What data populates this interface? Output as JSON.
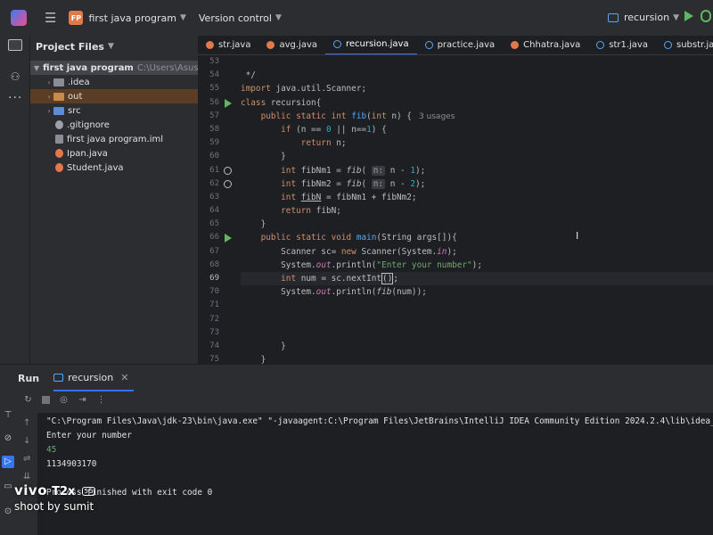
{
  "titlebar": {
    "project_badge": "FP",
    "project_name": "first java program",
    "version_control": "Version control",
    "run_config": "recursion"
  },
  "project_panel": {
    "title": "Project Files",
    "root_name": "first java program",
    "root_path": "C:\\Users\\Asus\\Id",
    "items": [
      {
        "label": ".idea",
        "kind": "folder"
      },
      {
        "label": "out",
        "kind": "folder-orange"
      },
      {
        "label": "src",
        "kind": "folder-blue"
      },
      {
        "label": ".gitignore",
        "kind": "git"
      },
      {
        "label": "first java program.iml",
        "kind": "iml"
      },
      {
        "label": "Ipan.java",
        "kind": "java"
      },
      {
        "label": "Student.java",
        "kind": "java"
      }
    ]
  },
  "editor": {
    "tabs": [
      {
        "label": "str.java",
        "icon": "java-icon"
      },
      {
        "label": "avg.java",
        "icon": "java-icon"
      },
      {
        "label": "recursion.java",
        "icon": "class-icon",
        "active": true
      },
      {
        "label": "practice.java",
        "icon": "class-icon"
      },
      {
        "label": "Chhatra.java",
        "icon": "java-icon"
      },
      {
        "label": "str1.java",
        "icon": "class-icon"
      },
      {
        "label": "substr.ja",
        "icon": "class-icon"
      }
    ],
    "line_numbers": [
      "53",
      "54",
      "55",
      "56",
      "57",
      "58",
      "59",
      "60",
      "61",
      "62",
      "63",
      "64",
      "65",
      "66",
      "67",
      "68",
      "69",
      "70",
      "71",
      "72",
      "73",
      "74",
      "75"
    ],
    "usages_hint": "3 usages",
    "param_hint": "n:"
  },
  "run_panel": {
    "title": "Run",
    "tab_label": "recursion",
    "console": {
      "command": "\"C:\\Program Files\\Java\\jdk-23\\bin\\java.exe\" \"-javaagent:C:\\Program Files\\JetBrains\\IntelliJ IDEA Community Edition 2024.2.4\\lib\\idea_r",
      "prompt": "Enter your number",
      "input": "45",
      "output": "1134903170",
      "exit": "Process finished with exit code 0"
    }
  },
  "watermark": {
    "brand": "vivo",
    "model": "T2x",
    "network": "5G",
    "caption": "shoot by sumit"
  }
}
